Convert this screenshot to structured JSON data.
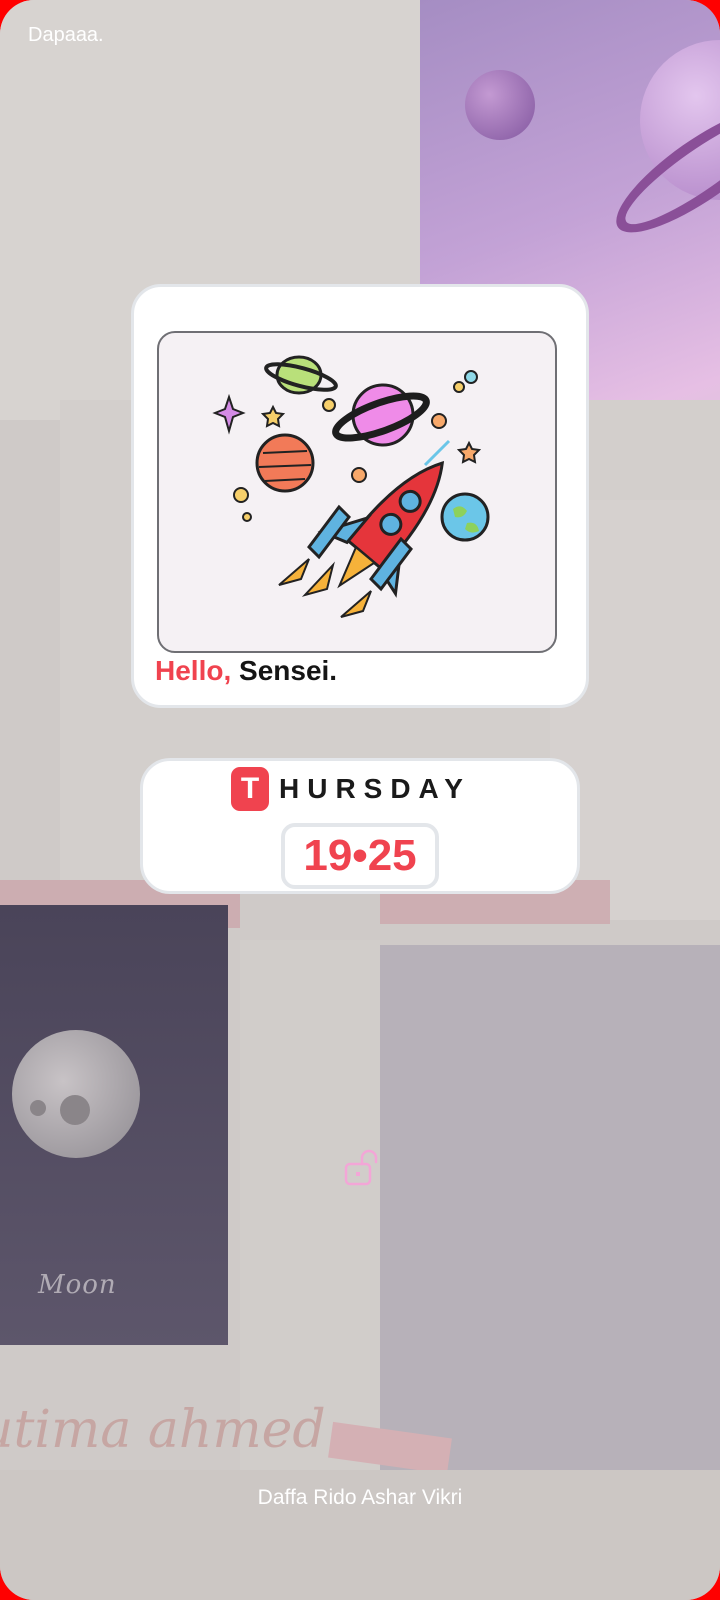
{
  "status_bar": {
    "carrier": "Dapaaa."
  },
  "photo_widget": {
    "greeting_accent": "Hello,",
    "greeting_name": "Sensei."
  },
  "date_widget": {
    "day_initial": "T",
    "day_rest": "HURSDAY",
    "time": "19•25"
  },
  "lock_screen": {
    "lock_icon": "unlocked-padlock-icon",
    "owner_name": "Daffa Rido Ashar Vikri"
  },
  "wallpaper": {
    "moon_caption": "Moon",
    "script_caption": "utima ahmed"
  },
  "colors": {
    "accent": "#f0434f",
    "frame": "#ff0000",
    "widget_bg": "#ffffff"
  }
}
